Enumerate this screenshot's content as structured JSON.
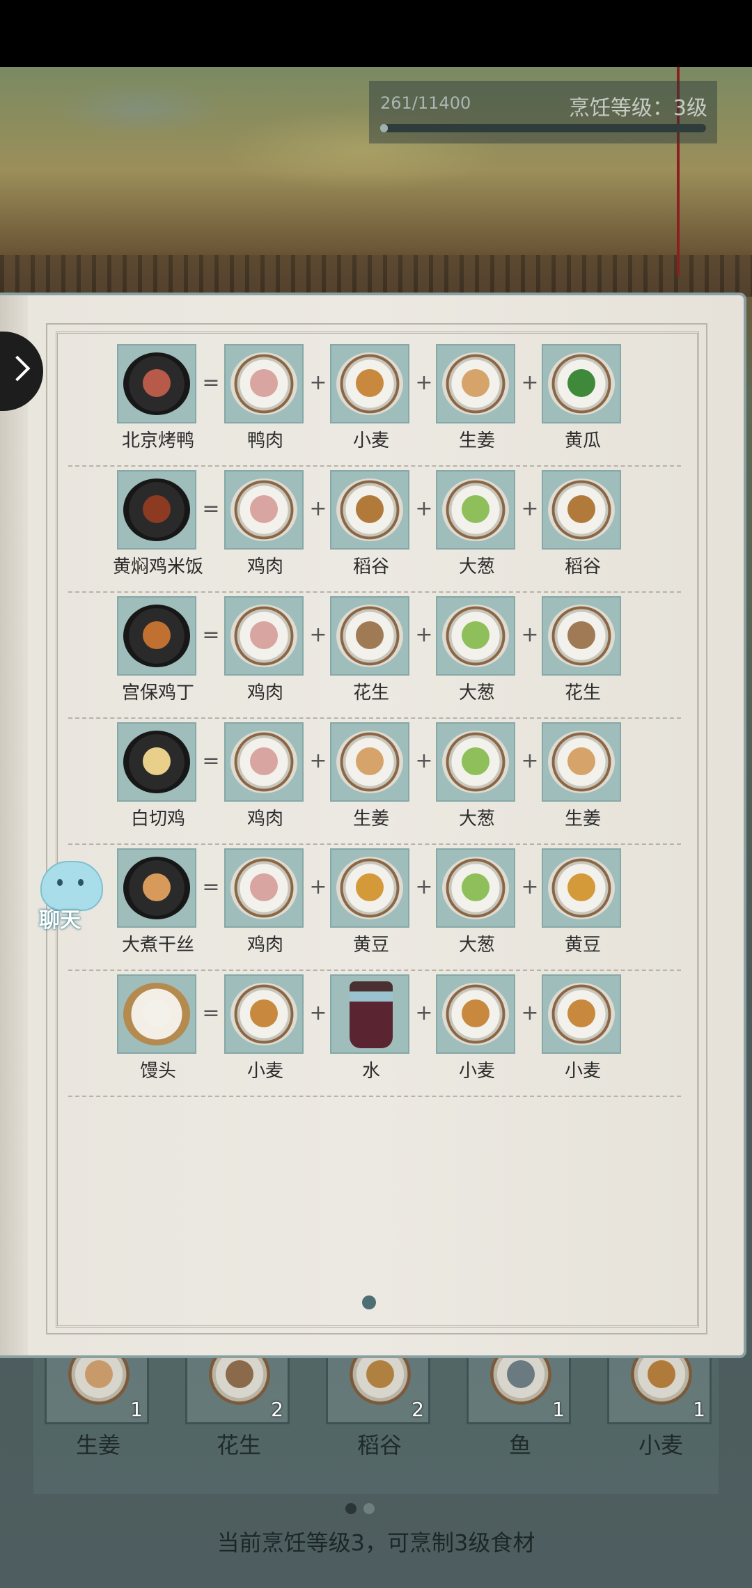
{
  "hud": {
    "exp_text": "261/11400",
    "exp_fraction": 0.0229,
    "level_text": "烹饪等级：3级"
  },
  "recipes": [
    {
      "dish": {
        "name": "北京烤鸭",
        "icon": "roast-duck-icon",
        "color": "#b85a4a"
      },
      "ingredients": [
        {
          "name": "鸭肉",
          "icon": "meat-icon",
          "color": "#d9a5a0"
        },
        {
          "name": "小麦",
          "icon": "wheat-icon",
          "color": "#c8893e"
        },
        {
          "name": "生姜",
          "icon": "ginger-icon",
          "color": "#d6a46a"
        },
        {
          "name": "黄瓜",
          "icon": "cucumber-icon",
          "color": "#3f8a3a"
        }
      ]
    },
    {
      "dish": {
        "name": "黄焖鸡米饭",
        "icon": "braised-chicken-rice-icon",
        "color": "#8c3a22"
      },
      "ingredients": [
        {
          "name": "鸡肉",
          "icon": "meat-icon",
          "color": "#d9a5a0"
        },
        {
          "name": "稻谷",
          "icon": "rice-grain-icon",
          "color": "#b27a3a"
        },
        {
          "name": "大葱",
          "icon": "scallion-icon",
          "color": "#8fbf5a"
        },
        {
          "name": "稻谷",
          "icon": "rice-grain-icon",
          "color": "#b27a3a"
        }
      ]
    },
    {
      "dish": {
        "name": "宫保鸡丁",
        "icon": "kung-pao-chicken-icon",
        "color": "#c07030"
      },
      "ingredients": [
        {
          "name": "鸡肉",
          "icon": "meat-icon",
          "color": "#d9a5a0"
        },
        {
          "name": "花生",
          "icon": "peanut-icon",
          "color": "#a07a55"
        },
        {
          "name": "大葱",
          "icon": "scallion-icon",
          "color": "#8fbf5a"
        },
        {
          "name": "花生",
          "icon": "peanut-icon",
          "color": "#a07a55"
        }
      ]
    },
    {
      "dish": {
        "name": "白切鸡",
        "icon": "white-cut-chicken-icon",
        "color": "#e8cf8a"
      },
      "ingredients": [
        {
          "name": "鸡肉",
          "icon": "meat-icon",
          "color": "#d9a5a0"
        },
        {
          "name": "生姜",
          "icon": "ginger-icon",
          "color": "#d6a46a"
        },
        {
          "name": "大葱",
          "icon": "scallion-icon",
          "color": "#8fbf5a"
        },
        {
          "name": "生姜",
          "icon": "ginger-icon",
          "color": "#d6a46a"
        }
      ]
    },
    {
      "dish": {
        "name": "大煮干丝",
        "icon": "tofu-shreds-icon",
        "color": "#d89a5a"
      },
      "ingredients": [
        {
          "name": "鸡肉",
          "icon": "meat-icon",
          "color": "#d9a5a0"
        },
        {
          "name": "黄豆",
          "icon": "soybean-icon",
          "color": "#d49a3a"
        },
        {
          "name": "大葱",
          "icon": "scallion-icon",
          "color": "#8fbf5a"
        },
        {
          "name": "黄豆",
          "icon": "soybean-icon",
          "color": "#d49a3a"
        }
      ]
    },
    {
      "dish": {
        "name": "馒头",
        "icon": "steamed-bun-icon",
        "color": "#f4f1ea"
      },
      "ingredients": [
        {
          "name": "小麦",
          "icon": "wheat-icon",
          "color": "#c8893e"
        },
        {
          "name": "水",
          "icon": "water-bucket-icon",
          "color": "#9bc3cf"
        },
        {
          "name": "小麦",
          "icon": "wheat-icon",
          "color": "#c8893e"
        },
        {
          "name": "小麦",
          "icon": "wheat-icon",
          "color": "#c8893e"
        }
      ]
    }
  ],
  "symbols": {
    "equals": "=",
    "plus": "+"
  },
  "chat": {
    "label": "聊天"
  },
  "inventory": [
    {
      "name": "生姜",
      "count": "1",
      "color": "#c89a6a"
    },
    {
      "name": "花生",
      "count": "2",
      "color": "#8a6a4a"
    },
    {
      "name": "稻谷",
      "count": "2",
      "color": "#b08040"
    },
    {
      "name": "鱼",
      "count": "1",
      "color": "#6a7a80"
    },
    {
      "name": "小麦",
      "count": "1",
      "color": "#b07a3a"
    }
  ],
  "status": {
    "text": "当前烹饪等级3，可烹制3级食材"
  }
}
